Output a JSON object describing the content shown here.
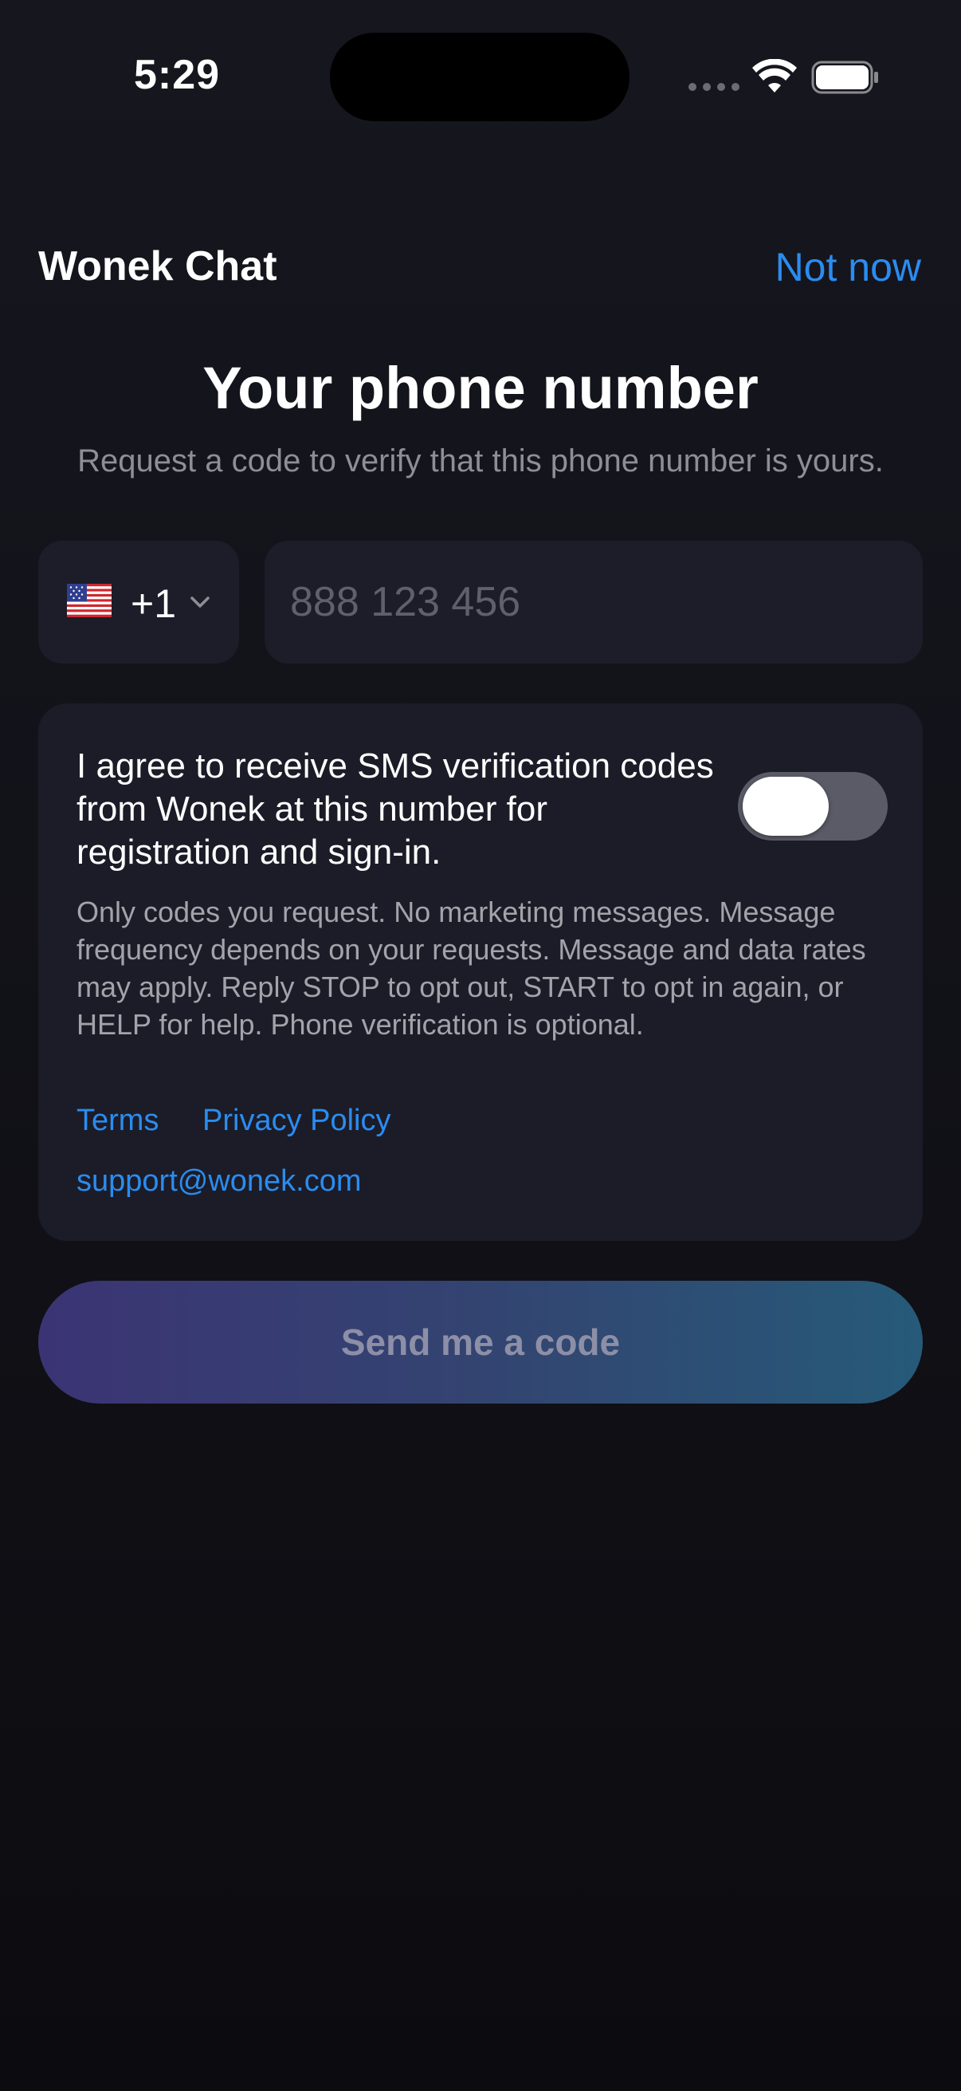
{
  "status_bar": {
    "time": "5:29"
  },
  "header": {
    "app_title": "Wonek Chat",
    "not_now_label": "Not now"
  },
  "main": {
    "heading": "Your phone number",
    "subheading": "Request a code to verify that this phone number is yours."
  },
  "phone": {
    "country_flag": "us-flag-icon",
    "dial_code": "+1",
    "number_value": "",
    "number_placeholder": "888 123 456"
  },
  "consent": {
    "agreement_text": "I agree to receive SMS verification codes from Wonek at this number for registration and sign-in.",
    "toggle_on": false,
    "details_text": "Only codes you request. No marketing messages. Message frequency depends on your requests. Message and data rates may apply. Reply STOP to opt out, START to opt in again, or HELP for help. Phone verification is optional.",
    "terms_label": "Terms",
    "privacy_label": "Privacy Policy",
    "support_email": "support@wonek.com"
  },
  "actions": {
    "send_label": "Send me a code"
  },
  "colors": {
    "accent": "#2b8cf0",
    "background": "#121219",
    "card": "#1b1c27",
    "button_gradient_start": "#3b3474",
    "button_gradient_end": "#265a78"
  }
}
